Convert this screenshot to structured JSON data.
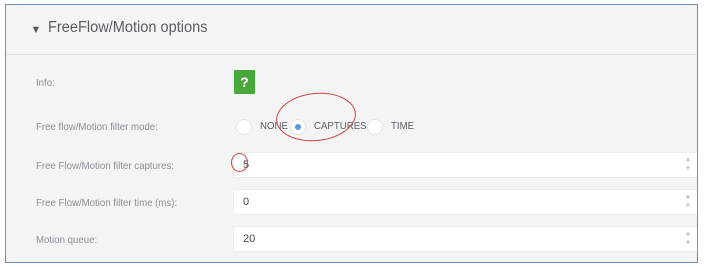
{
  "panel": {
    "title": "FreeFlow/Motion options",
    "toggle_icon": "triangle-down-icon"
  },
  "info": {
    "label": "Info:",
    "button_text": "?",
    "button_color": "#49a83c"
  },
  "filter_mode": {
    "label": "Free flow/Motion filter mode:",
    "options": [
      {
        "label": "NONE",
        "selected": false
      },
      {
        "label": "CAPTURES",
        "selected": true
      },
      {
        "label": "TIME",
        "selected": false
      }
    ]
  },
  "filter_captures": {
    "label": "Free Flow/Motion filter captures:",
    "value": "5"
  },
  "filter_time": {
    "label": "Free Flow/Motion filter time (ms):",
    "value": "0"
  },
  "motion_queue": {
    "label": "Motion queue:",
    "value": "20"
  },
  "colors": {
    "frame_border": "#6b8fc7",
    "accent_radio": "#5b97e0",
    "annotation": "#c9453f"
  }
}
